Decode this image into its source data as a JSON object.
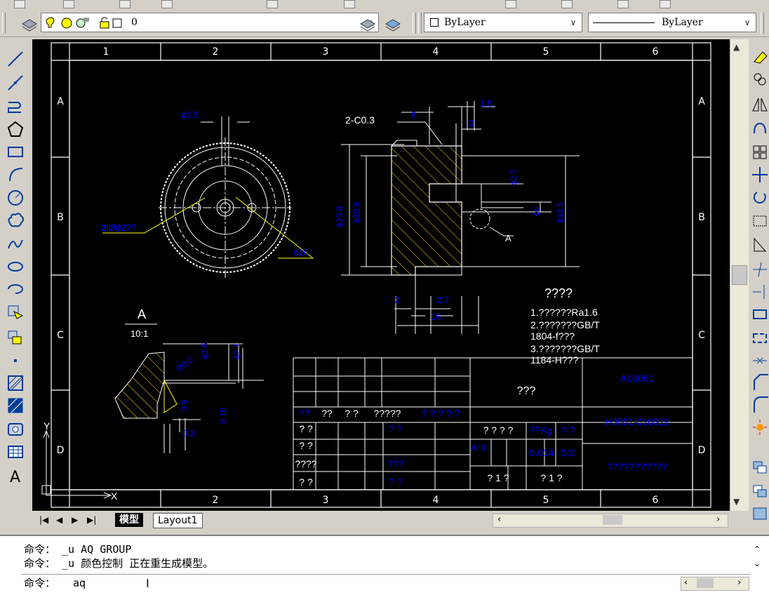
{
  "layer_toolbar": {
    "layer_combo": "0",
    "color_combo": "ByLayer",
    "linetype_combo": "ByLayer",
    "combo_arrow": "∨"
  },
  "drawing": {
    "col_labels": [
      "1",
      "2",
      "3",
      "4",
      "5",
      "6"
    ],
    "row_labels": [
      "A",
      "B",
      "C",
      "D"
    ],
    "dims_left_view": {
      "d25": "ϕ2.5",
      "holes": "2IØϕ2??",
      "d10": "ϕ10"
    },
    "dims_section": {
      "chamfer": "2-C0.3",
      "d8": "8",
      "d15": "1.5",
      "d3": "3",
      "d238": "ϕ23.8",
      "d209": "ϕ20.9",
      "d25": "ϕ2.5",
      "d6": "ϕ6",
      "d185": "ϕ18.5",
      "callout_a": "A",
      "d2": "2",
      "d27": "2.7",
      "d16": "16"
    },
    "detail": {
      "label": "A",
      "scale": "10:1",
      "r02": "R0.2",
      "d25": "ϕ2.5",
      "d21": "ϕ2.1",
      "d08": "0.8",
      "d015": "0.15",
      "d03": "0.3"
    },
    "notes": {
      "title": "????",
      "n1": "1.??????Ra1.6",
      "n2": "2.???????GB/T",
      "n2b": "1804-f???",
      "n3": "3.???????GB/T",
      "n3b": "1184-H???"
    },
    "title_block": {
      "material": "AL6061",
      "part_no": "HJ001-010311",
      "part_name": "???",
      "company": "???????????",
      "mass": "??Kg",
      "scale": "5:2",
      "weight": "0.014",
      "sheet_a": "? 1 ?",
      "sheet_b": "? 1 ?",
      "review": "? ? ? ?",
      "hdr1": "??",
      "hdr2": "??",
      "hdr3": "? ?",
      "hdr4": "?????",
      "hdr5": "? ? ? ? ?",
      "row_a": "? ?",
      "row_b": "? ?",
      "row_c": "????",
      "row_d": "? ?",
      "blue_1": "? ?",
      "blue_2": "???",
      "blue_3": "? ?",
      "blue_4": "? ?",
      "blue_5": "A/ 0",
      "blue_6": "? ?"
    },
    "ucs": {
      "x": "X",
      "y": "Y"
    }
  },
  "tabs": {
    "model": "模型",
    "layout1": "Layout1",
    "nav": [
      "|◀",
      "◀",
      "▶",
      "▶|"
    ]
  },
  "command": {
    "history": [
      "命令： _u AQ GROUP",
      "命令： _u 颜色控制 正在重生成模型。"
    ],
    "prompt": "命令：",
    "input": "aq"
  }
}
